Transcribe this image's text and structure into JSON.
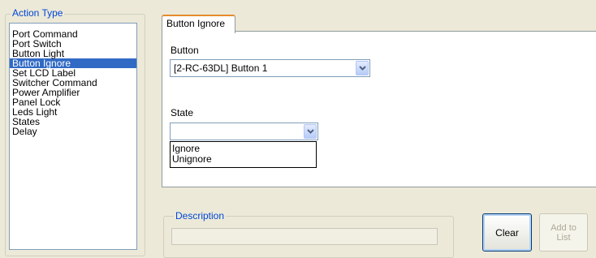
{
  "action_type": {
    "legend": "Action Type",
    "items": [
      {
        "label": "Port Command"
      },
      {
        "label": "Port Switch"
      },
      {
        "label": "Button Light"
      },
      {
        "label": "Button Ignore"
      },
      {
        "label": "Set LCD Label"
      },
      {
        "label": "Switcher Command"
      },
      {
        "label": "Power Amplifier"
      },
      {
        "label": "Panel Lock"
      },
      {
        "label": "Leds Light"
      },
      {
        "label": "States"
      },
      {
        "label": "Delay"
      }
    ],
    "selected_label": "Button Ignore"
  },
  "tab": {
    "label": "Button Ignore"
  },
  "button_field": {
    "label": "Button",
    "value": "[2-RC-63DL] Button 1"
  },
  "state_field": {
    "label": "State",
    "value": "",
    "options": [
      {
        "label": "Ignore"
      },
      {
        "label": "Unignore"
      }
    ]
  },
  "description": {
    "legend": "Description",
    "value": ""
  },
  "actions": {
    "clear_label": "Clear",
    "add_line1": "Add to",
    "add_line2": "List"
  },
  "colors": {
    "accent": "#316ac5",
    "tab_highlight": "#e68b2c",
    "legend_text": "#0046d5"
  }
}
